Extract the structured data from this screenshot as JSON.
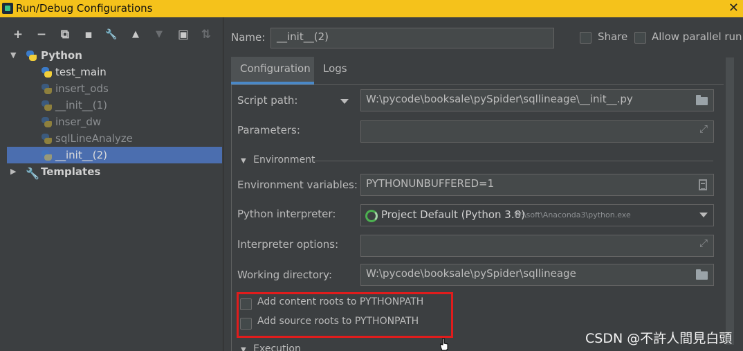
{
  "window": {
    "title": "Run/Debug Configurations",
    "close_glyph": "✕"
  },
  "toolbar": {
    "add": "+",
    "remove": "−",
    "copy": "⧉",
    "save": "▪",
    "edit": "🔧",
    "up": "▲",
    "down": "▼",
    "new_folder": "▣",
    "sort": "⇅"
  },
  "tree": {
    "root": "Python",
    "items": [
      "test_main",
      "insert_ods",
      "__init__(1)",
      "inser_dw",
      "sqlLineAnalyze",
      "__init__(2)"
    ],
    "templates": "Templates"
  },
  "config": {
    "name_label": "Name:",
    "name_value": "__init__(2)",
    "share_label": "Share",
    "parallel_label": "Allow parallel run",
    "tabs": [
      "Configuration",
      "Logs"
    ],
    "script_path_label": "Script path:",
    "script_path_value": "W:\\pycode\\booksale\\pySpider\\sqllineage\\__init__.py",
    "parameters_label": "Parameters:",
    "parameters_value": "",
    "environment_section": "Environment",
    "env_vars_label": "Environment variables:",
    "env_vars_value": "PYTHONUNBUFFERED=1",
    "interpreter_label": "Python interpreter:",
    "interpreter_value": "Project Default (Python 3.8)",
    "interpreter_path": "W:\\soft\\Anaconda3\\python.exe",
    "interp_options_label": "Interpreter options:",
    "interp_options_value": "",
    "working_dir_label": "Working directory:",
    "working_dir_value": "W:\\pycode\\booksale\\pySpider\\sqllineage",
    "add_content_roots": "Add content roots to PYTHONPATH",
    "add_source_roots": "Add source roots to PYTHONPATH",
    "execution_section": "Execution"
  },
  "watermark": "CSDN @不許人間見白頭",
  "colors": {
    "titlebar": "#f5c21b",
    "selection": "#4b6eaf",
    "highlight_box": "#e01c1c",
    "tab_underline": "#4a88c7"
  }
}
